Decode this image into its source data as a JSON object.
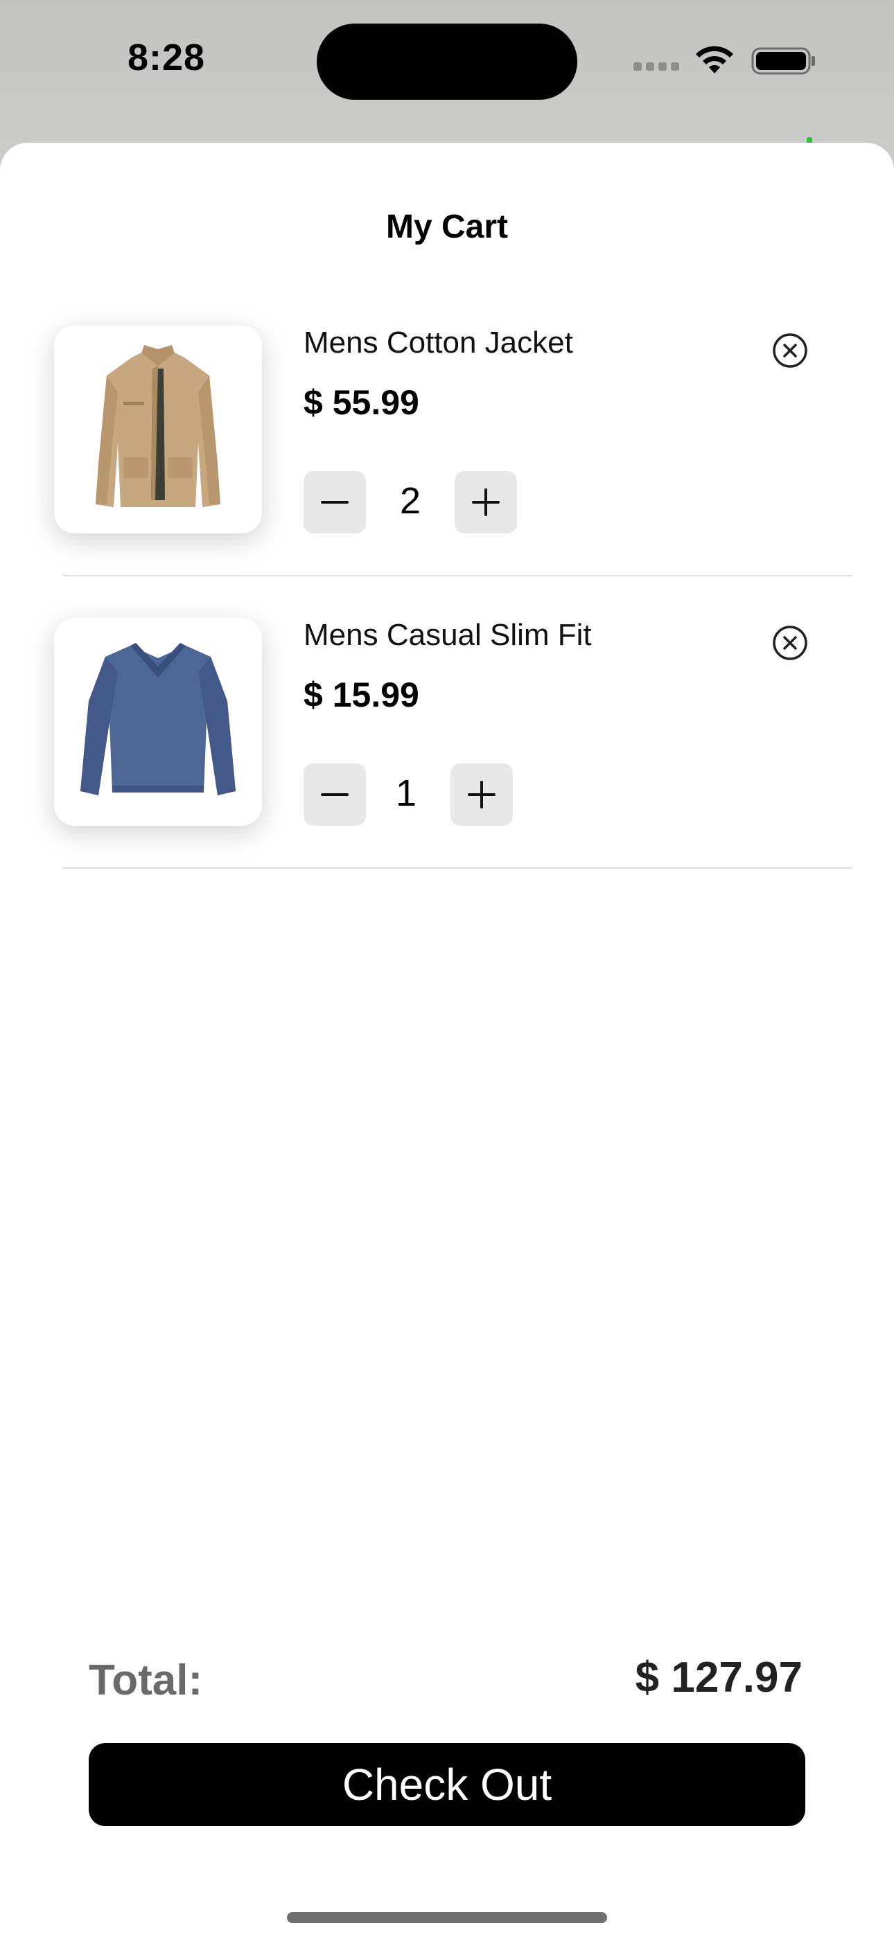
{
  "status_bar": {
    "time": "8:28",
    "icons": [
      "signal-icon",
      "wifi-icon",
      "battery-icon"
    ]
  },
  "cart": {
    "title": "My Cart",
    "items": [
      {
        "name": "Mens Cotton Jacket",
        "price": "$ 55.99",
        "quantity": "2",
        "image_icon": "jacket-image"
      },
      {
        "name": "Mens Casual Slim Fit",
        "price": "$ 15.99",
        "quantity": "1",
        "image_icon": "shirt-image"
      }
    ],
    "decrement_icon": "minus-icon",
    "increment_icon": "plus-icon",
    "remove_icon": "close-circle-icon"
  },
  "summary": {
    "total_label": "Total:",
    "total_value": "$ 127.97"
  },
  "actions": {
    "checkout_label": "Check Out"
  },
  "colors": {
    "accent": "#000000",
    "qty_button_bg": "#e8e8e8",
    "total_label": "#6a6a6a"
  }
}
